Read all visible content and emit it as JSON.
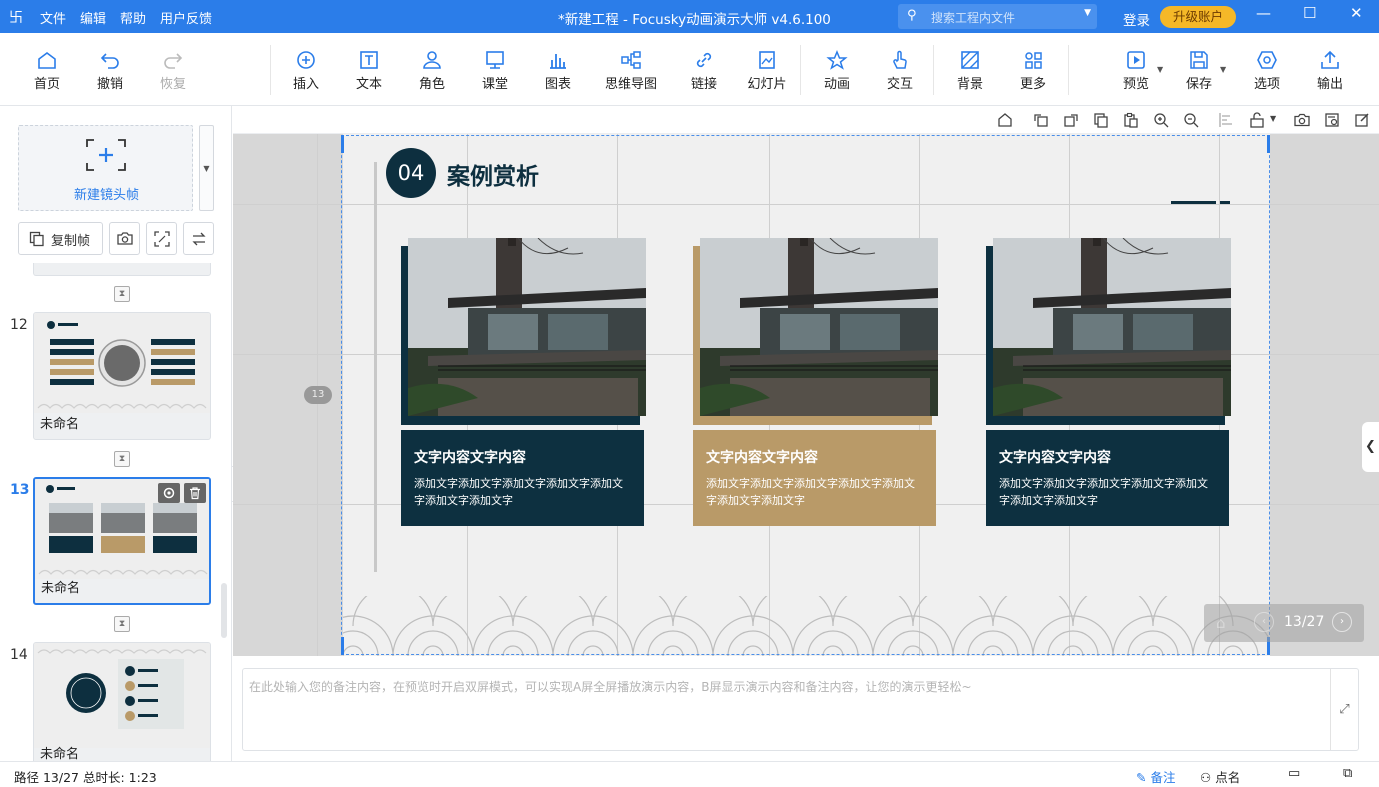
{
  "app": {
    "title": "*新建工程 - Focusky动画演示大师  v4.6.100",
    "menu": [
      "文件",
      "编辑",
      "帮助",
      "用户反馈"
    ],
    "search_placeholder": "搜索工程内文件",
    "login": "登录",
    "upgrade": "升级账户"
  },
  "toolbar": {
    "home": "首页",
    "undo": "撤销",
    "redo": "恢复",
    "insert": "插入",
    "text": "文本",
    "role": "角色",
    "classroom": "课堂",
    "chart": "图表",
    "mindmap": "思维导图",
    "link": "链接",
    "slides": "幻灯片",
    "animation": "动画",
    "interaction": "交互",
    "background": "背景",
    "more": "更多",
    "preview": "预览",
    "save": "保存",
    "options": "选项",
    "export": "输出"
  },
  "sidebar": {
    "new_frame": "新建镜头帧",
    "copy_frame": "复制帧",
    "thumbnails": [
      {
        "number": "12",
        "name": "未命名"
      },
      {
        "number": "13",
        "name": "未命名"
      },
      {
        "number": "14",
        "name": "未命名"
      }
    ]
  },
  "slide": {
    "number": "04",
    "title": "案例赏析",
    "page_badge": "13",
    "cards": [
      {
        "heading": "文字内容文字内容",
        "body": "添加文字添加文字添加文字添加文字添加文字添加文字添加文字"
      },
      {
        "heading": "文字内容文字内容",
        "body": "添加文字添加文字添加文字添加文字添加文字添加文字添加文字"
      },
      {
        "heading": "文字内容文字内容",
        "body": "添加文字添加文字添加文字添加文字添加文字添加文字添加文字"
      }
    ],
    "card_colors": [
      "#0d3040",
      "#b99a68",
      "#0d3040"
    ],
    "page_indicator": "13/27"
  },
  "notes": {
    "placeholder": "在此处输入您的备注内容，在预览时开启双屏模式，可以实现A屏全屏播放演示内容，B屏显示演示内容和备注内容，让您的演示更轻松~"
  },
  "status": {
    "path": "路径 13/27",
    "duration": "总时长: 1:23",
    "notes_btn": "备注",
    "rollcall_btn": "点名"
  }
}
